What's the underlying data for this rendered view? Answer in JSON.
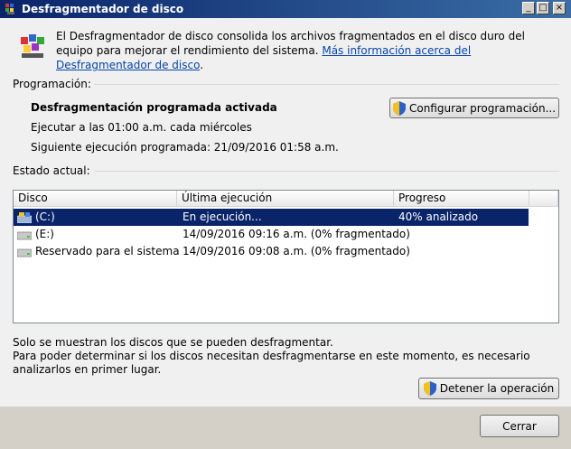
{
  "window": {
    "title": "Desfragmentador de disco"
  },
  "titlebar_buttons": {
    "minimize": "_",
    "maximize": "□",
    "close": "×"
  },
  "header": {
    "description": "El Desfragmentador de disco consolida los archivos fragmentados en el disco duro del equipo para mejorar el rendimiento del sistema.",
    "more_info_link": "Más información acerca del Desfragmentador de disco"
  },
  "schedule": {
    "section_label": "Programación:",
    "status": "Desfragmentación programada activada",
    "run_at": "Ejecutar a las 01:00 a.m. cada miércoles",
    "next_run": "Siguiente ejecución programada: 21/09/2016 01:58 a.m.",
    "configure_button": "Configurar programación..."
  },
  "current": {
    "section_label": "Estado actual:",
    "columns": [
      "Disco",
      "Última ejecución",
      "Progreso"
    ],
    "rows": [
      {
        "disk": "(C:)",
        "last_run": "En ejecución...",
        "progress": "40% analizado",
        "selected": true
      },
      {
        "disk": "(E:)",
        "last_run": "14/09/2016 09:16 a.m. (0% fragmentado)",
        "progress": ""
      },
      {
        "disk": "Reservado para el sistema",
        "last_run": "14/09/2016 09:08 a.m. (0% fragmentado)",
        "progress": ""
      }
    ]
  },
  "footer": {
    "note1": "Solo se muestran los discos que se pueden desfragmentar.",
    "note2": "Para poder determinar si los discos necesitan desfragmentarse en este momento, es necesario analizarlos en primer lugar.",
    "stop_button": "Detener la operación",
    "close_button": "Cerrar"
  },
  "icons": {
    "app": "defrag-icon",
    "shield": "uac-shield-icon",
    "drive": "hard-drive-icon",
    "system_drive": "system-drive-icon"
  },
  "colors": {
    "selection": "#0a246a",
    "link": "#0645ad"
  }
}
